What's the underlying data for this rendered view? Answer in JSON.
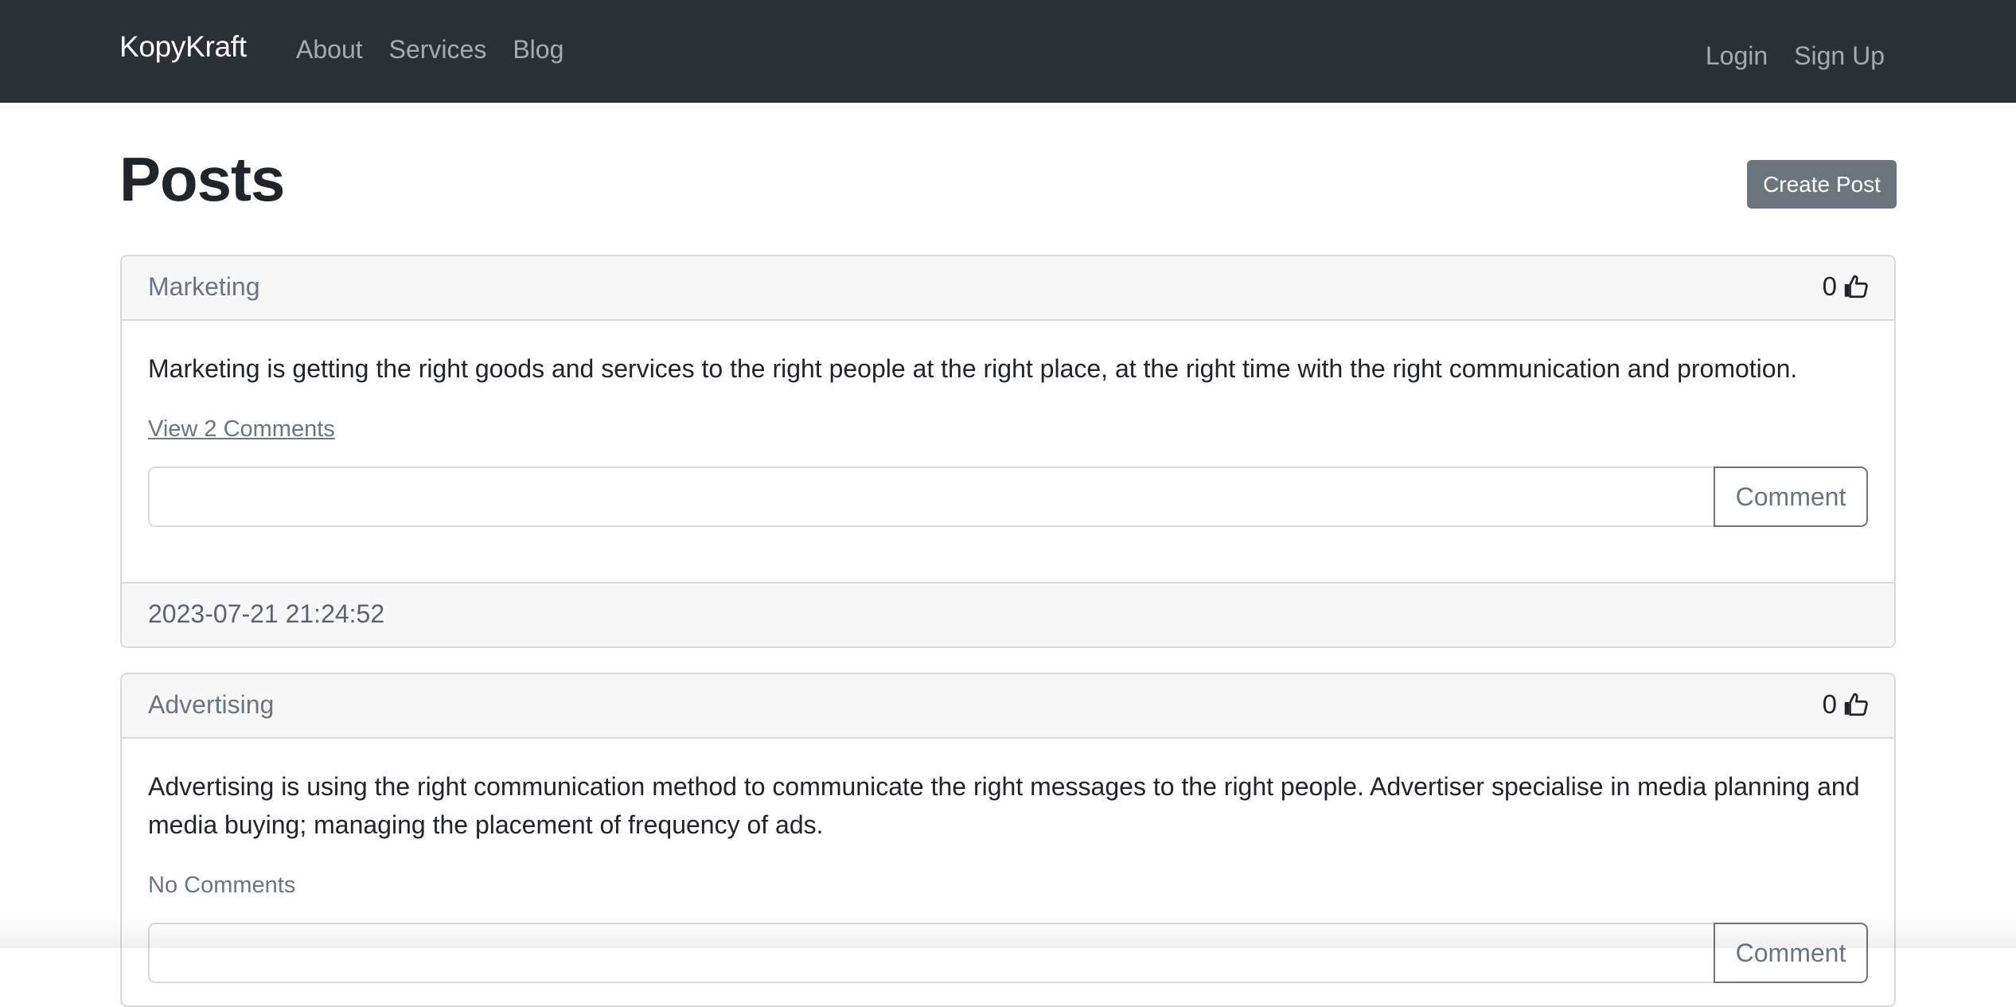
{
  "navbar": {
    "brand": "KopyKraft",
    "links": [
      {
        "label": "About"
      },
      {
        "label": "Services"
      },
      {
        "label": "Blog"
      }
    ],
    "right": [
      {
        "label": "Login"
      },
      {
        "label": "Sign Up"
      }
    ]
  },
  "header": {
    "title": "Posts",
    "create_label": "Create Post"
  },
  "posts": [
    {
      "title": "Marketing",
      "likes": "0",
      "text": "Marketing is getting the right goods and services to the right people at the right place, at the right time with the right communication and promotion.",
      "comments_label": "View 2 Comments",
      "comment_value": "",
      "comment_button": "Comment",
      "timestamp": "2023-07-21 21:24:52"
    },
    {
      "title": "Advertising",
      "likes": "0",
      "text": "Advertising is using the right communication method to communicate the right messages to the right people. Advertiser specialise in media planning and media buying; managing the placement of frequency of ads.",
      "comments_label": "No Comments",
      "comment_value": "",
      "comment_button": "Comment"
    }
  ],
  "icons": {
    "like": "thumbs-up-icon"
  },
  "colors": {
    "navbar_bg": "#2b3035",
    "secondary": "#6c757d",
    "card_header_bg": "#f7f7f8"
  }
}
